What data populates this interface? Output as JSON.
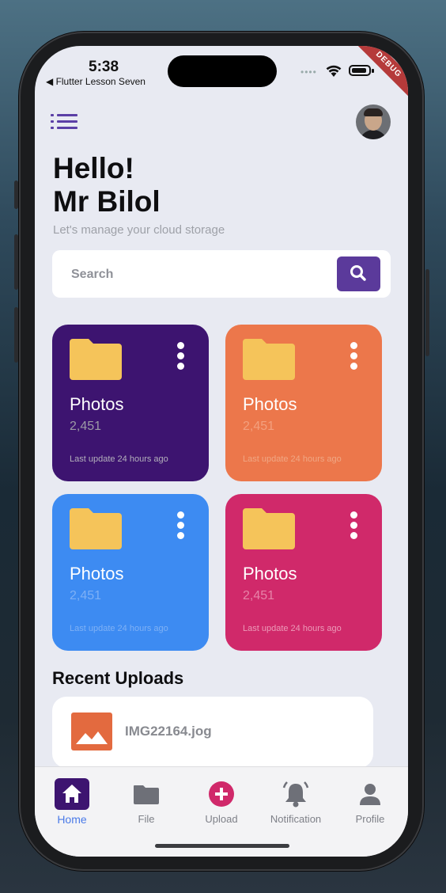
{
  "status_bar": {
    "time": "5:38",
    "back_app": "◀ Flutter Lesson Seven",
    "debug_banner": "DEBUG"
  },
  "header": {
    "greeting": "Hello!",
    "name": "Mr Bilol",
    "subtitle": "Let's manage your cloud storage"
  },
  "search": {
    "placeholder": "Search"
  },
  "folders": [
    {
      "title": "Photos",
      "count": "2,451",
      "updated": "Last update 24 hours ago",
      "color": "#3d1470"
    },
    {
      "title": "Photos",
      "count": "2,451",
      "updated": "Last update 24 hours ago",
      "color": "#ec774b"
    },
    {
      "title": "Photos",
      "count": "2,451",
      "updated": "Last update 24 hours ago",
      "color": "#3d8bf2"
    },
    {
      "title": "Photos",
      "count": "2,451",
      "updated": "Last update 24 hours ago",
      "color": "#d0296a"
    }
  ],
  "folder_icon_color": "#f5c45a",
  "recent": {
    "title": "Recent Uploads",
    "items": [
      {
        "name": "IMG22164.jog",
        "icon": "image-icon"
      }
    ]
  },
  "nav": {
    "items": [
      {
        "label": "Home",
        "icon": "home-icon",
        "active": true
      },
      {
        "label": "File",
        "icon": "folder-icon",
        "active": false
      },
      {
        "label": "Upload",
        "icon": "plus-circle-icon",
        "active": false
      },
      {
        "label": "Notification",
        "icon": "bell-icon",
        "active": false
      },
      {
        "label": "Profile",
        "icon": "person-icon",
        "active": false
      }
    ],
    "active_color": "#4a7ae8",
    "active_bg": "#3d1470"
  }
}
